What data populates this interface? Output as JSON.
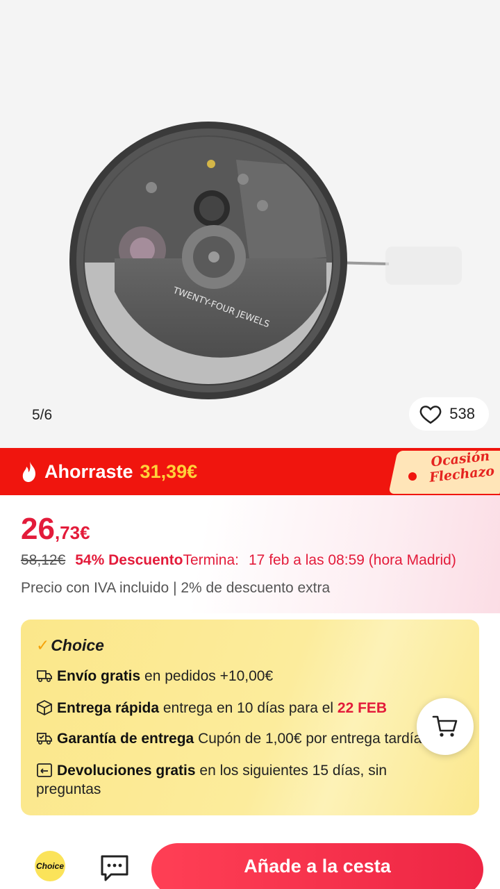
{
  "gallery": {
    "counter": "5/6",
    "likes": "538",
    "engraving": "TWENTY-FOUR JEWELS"
  },
  "promo": {
    "label": "Ahorraste",
    "value": "31,39€",
    "tag": "Ocasión Flechazo",
    "icon": "flame-icon",
    "color": "#f0150e"
  },
  "price": {
    "integer": "26",
    "decimal": ",73€",
    "old": "58,12€",
    "discount": "54% Descuento",
    "ends_label": "Termina:",
    "ends_value": "17 feb a las 08:59 (hora Madrid)",
    "vat_note": "Precio con IVA incluido | 2% de descuento extra",
    "color": "#e31b3a"
  },
  "choice": {
    "title": "Choice",
    "benefits": [
      {
        "icon": "truck-icon",
        "bold": "Envío gratis",
        "text": " en pedidos +10,00€"
      },
      {
        "icon": "box-icon",
        "bold": "Entrega rápida",
        "text": " entrega en 10 días para el ",
        "highlight": "22 FEB"
      },
      {
        "icon": "delivery-guarantee-icon",
        "bold": "Garantía de entrega",
        "text": "  Cupón de 1,00€ por entrega tardía"
      },
      {
        "icon": "return-icon",
        "bold": "Devoluciones gratis",
        "text": "  en los siguientes 15 días, sin preguntas"
      }
    ]
  },
  "bottom": {
    "choice_logo": "Choice",
    "add_to_cart": "Añade a la cesta"
  }
}
